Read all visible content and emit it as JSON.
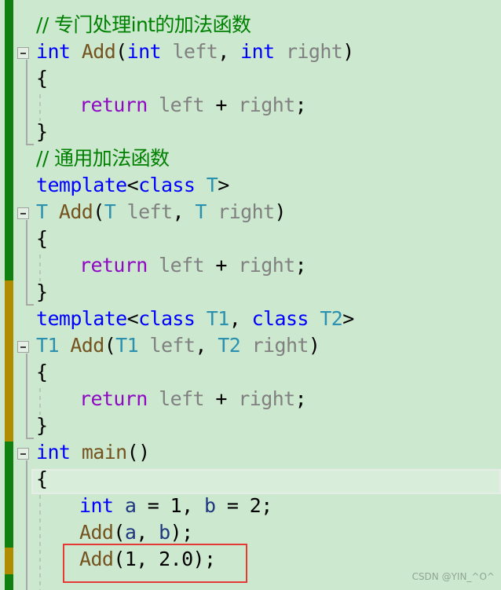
{
  "editor": {
    "language": "C++",
    "colors": {
      "background": "#cce8cf",
      "change_saved": "#108010",
      "change_unsaved": "#b08c00",
      "highlight_box": "#e53935"
    },
    "lines": [
      {
        "tokens": [
          {
            "t": "// 专门处理int的加法函数",
            "c": "cm"
          }
        ]
      },
      {
        "tokens": [
          {
            "t": "int",
            "c": "kw"
          },
          {
            "t": " "
          },
          {
            "t": "Add",
            "c": "fn"
          },
          {
            "t": "("
          },
          {
            "t": "int",
            "c": "kw"
          },
          {
            "t": " "
          },
          {
            "t": "left",
            "c": "param"
          },
          {
            "t": ", "
          },
          {
            "t": "int",
            "c": "kw"
          },
          {
            "t": " "
          },
          {
            "t": "right",
            "c": "param"
          },
          {
            "t": ")"
          }
        ]
      },
      {
        "tokens": [
          {
            "t": "{"
          }
        ]
      },
      {
        "tokens": [
          {
            "t": "    "
          },
          {
            "t": "return",
            "c": "kw2"
          },
          {
            "t": " "
          },
          {
            "t": "left",
            "c": "param"
          },
          {
            "t": " + "
          },
          {
            "t": "right",
            "c": "param"
          },
          {
            "t": ";"
          }
        ]
      },
      {
        "tokens": [
          {
            "t": "}"
          }
        ]
      },
      {
        "tokens": [
          {
            "t": "// 通用加法函数",
            "c": "cm"
          }
        ]
      },
      {
        "tokens": [
          {
            "t": "template",
            "c": "kw"
          },
          {
            "t": "<"
          },
          {
            "t": "class",
            "c": "kw"
          },
          {
            "t": " "
          },
          {
            "t": "T",
            "c": "type"
          },
          {
            "t": ">"
          }
        ]
      },
      {
        "tokens": [
          {
            "t": "T",
            "c": "type"
          },
          {
            "t": " "
          },
          {
            "t": "Add",
            "c": "fn"
          },
          {
            "t": "("
          },
          {
            "t": "T",
            "c": "type"
          },
          {
            "t": " "
          },
          {
            "t": "left",
            "c": "param"
          },
          {
            "t": ", "
          },
          {
            "t": "T",
            "c": "type"
          },
          {
            "t": " "
          },
          {
            "t": "right",
            "c": "param"
          },
          {
            "t": ")"
          }
        ]
      },
      {
        "tokens": [
          {
            "t": "{"
          }
        ]
      },
      {
        "tokens": [
          {
            "t": "    "
          },
          {
            "t": "return",
            "c": "kw2"
          },
          {
            "t": " "
          },
          {
            "t": "left",
            "c": "param"
          },
          {
            "t": " + "
          },
          {
            "t": "right",
            "c": "param"
          },
          {
            "t": ";"
          }
        ]
      },
      {
        "tokens": [
          {
            "t": "}"
          }
        ]
      },
      {
        "tokens": [
          {
            "t": "template",
            "c": "kw"
          },
          {
            "t": "<"
          },
          {
            "t": "class",
            "c": "kw"
          },
          {
            "t": " "
          },
          {
            "t": "T1",
            "c": "type"
          },
          {
            "t": ", "
          },
          {
            "t": "class",
            "c": "kw"
          },
          {
            "t": " "
          },
          {
            "t": "T2",
            "c": "type"
          },
          {
            "t": ">"
          }
        ]
      },
      {
        "tokens": [
          {
            "t": "T1",
            "c": "type"
          },
          {
            "t": " "
          },
          {
            "t": "Add",
            "c": "fn"
          },
          {
            "t": "("
          },
          {
            "t": "T1",
            "c": "type"
          },
          {
            "t": " "
          },
          {
            "t": "left",
            "c": "param"
          },
          {
            "t": ", "
          },
          {
            "t": "T2",
            "c": "type"
          },
          {
            "t": " "
          },
          {
            "t": "right",
            "c": "param"
          },
          {
            "t": ")"
          }
        ]
      },
      {
        "tokens": [
          {
            "t": "{"
          }
        ]
      },
      {
        "tokens": [
          {
            "t": "    "
          },
          {
            "t": "return",
            "c": "kw2"
          },
          {
            "t": " "
          },
          {
            "t": "left",
            "c": "param"
          },
          {
            "t": " + "
          },
          {
            "t": "right",
            "c": "param"
          },
          {
            "t": ";"
          }
        ]
      },
      {
        "tokens": [
          {
            "t": "}"
          }
        ]
      },
      {
        "tokens": [
          {
            "t": "int",
            "c": "kw"
          },
          {
            "t": " "
          },
          {
            "t": "main",
            "c": "fn"
          },
          {
            "t": "()"
          }
        ]
      },
      {
        "tokens": [
          {
            "t": "{"
          }
        ]
      },
      {
        "tokens": [
          {
            "t": "    "
          },
          {
            "t": "int",
            "c": "kw"
          },
          {
            "t": " "
          },
          {
            "t": "a",
            "c": "var"
          },
          {
            "t": " = 1, "
          },
          {
            "t": "b",
            "c": "var"
          },
          {
            "t": " = 2;"
          }
        ]
      },
      {
        "tokens": [
          {
            "t": "    "
          },
          {
            "t": "Add",
            "c": "fn"
          },
          {
            "t": "("
          },
          {
            "t": "a",
            "c": "var"
          },
          {
            "t": ", "
          },
          {
            "t": "b",
            "c": "var"
          },
          {
            "t": ");"
          }
        ]
      },
      {
        "tokens": [
          {
            "t": "    "
          },
          {
            "t": "Add",
            "c": "fn"
          },
          {
            "t": "(1, 2.0);"
          }
        ]
      }
    ],
    "fold_lines": [
      1,
      7,
      12,
      16
    ],
    "current_line": 17,
    "highlighted_line": 20
  },
  "watermark": "CSDN @YIN_^O^"
}
